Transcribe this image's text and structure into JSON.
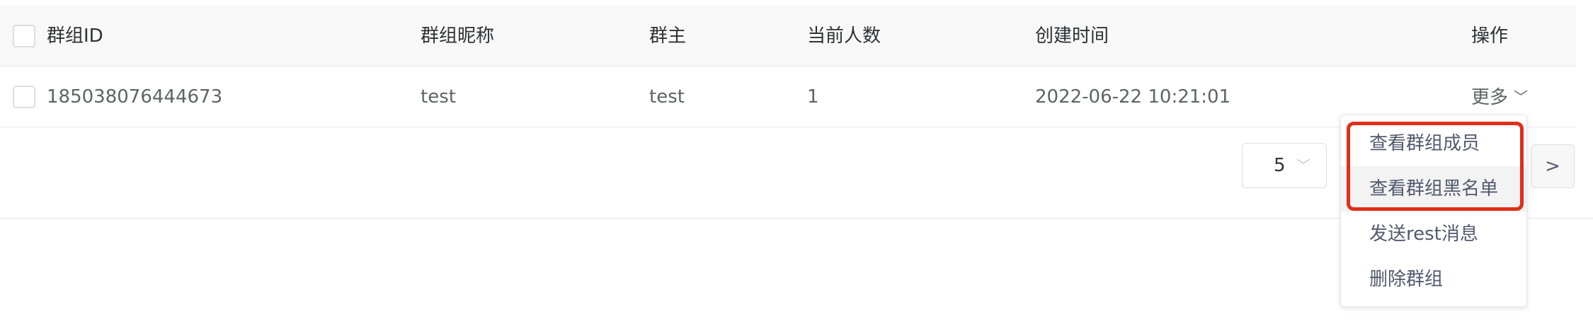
{
  "table": {
    "headers": {
      "group_id": "群组ID",
      "group_name": "群组昵称",
      "owner": "群主",
      "member_count": "当前人数",
      "created_at": "创建时间",
      "actions": "操作"
    },
    "rows": [
      {
        "group_id": "185038076444673",
        "group_name": "test",
        "owner": "test",
        "member_count": "1",
        "created_at": "2022-06-22 10:21:01",
        "action_label": "更多"
      }
    ]
  },
  "icons": {
    "chevron": "chevron-down-icon",
    "next": "chevron-right-icon"
  },
  "pagination": {
    "page_size": "5",
    "next_symbol": ">"
  },
  "dropdown": {
    "items": [
      "查看群组成员",
      "查看群组黑名单",
      "发送rest消息",
      "删除群组"
    ]
  },
  "colors": {
    "link": "#2d8cf0",
    "highlight": "#e02e1b"
  }
}
